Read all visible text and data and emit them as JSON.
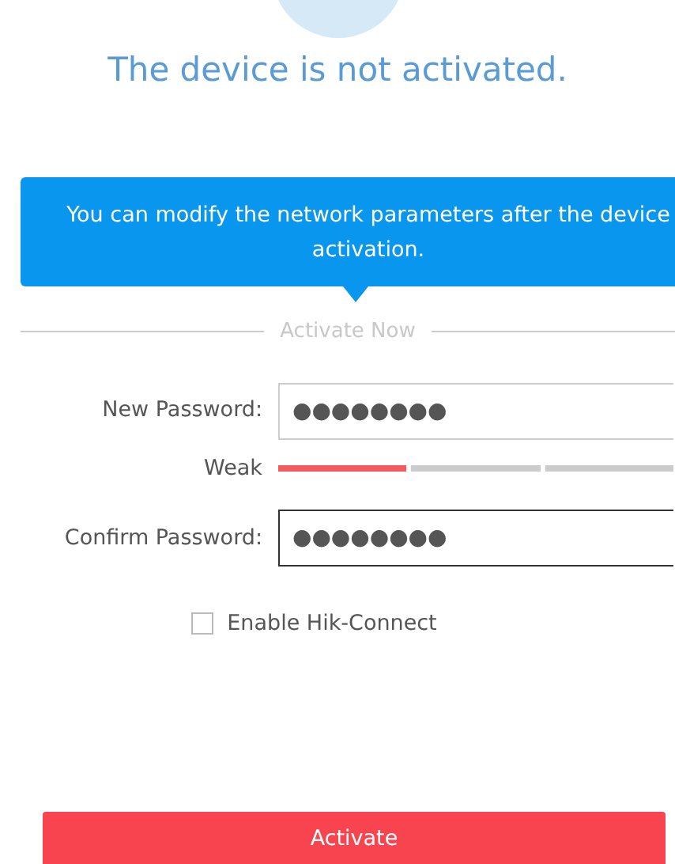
{
  "title": "The device is not activated.",
  "tooltip": "You can modify the network parameters after the device activation.",
  "section_heading": "Activate Now",
  "fields": [
    {
      "label": "New Password:",
      "value": "●●●●●●●●",
      "focused": false
    },
    {
      "label": "Confirm Password:",
      "value": "●●●●●●●●",
      "focused": true
    }
  ],
  "strength": {
    "label": "Weak",
    "level": 0.33
  },
  "hik_connect": {
    "label": "Enable Hik-Connect",
    "checked": false
  },
  "activate_button": "Activate"
}
